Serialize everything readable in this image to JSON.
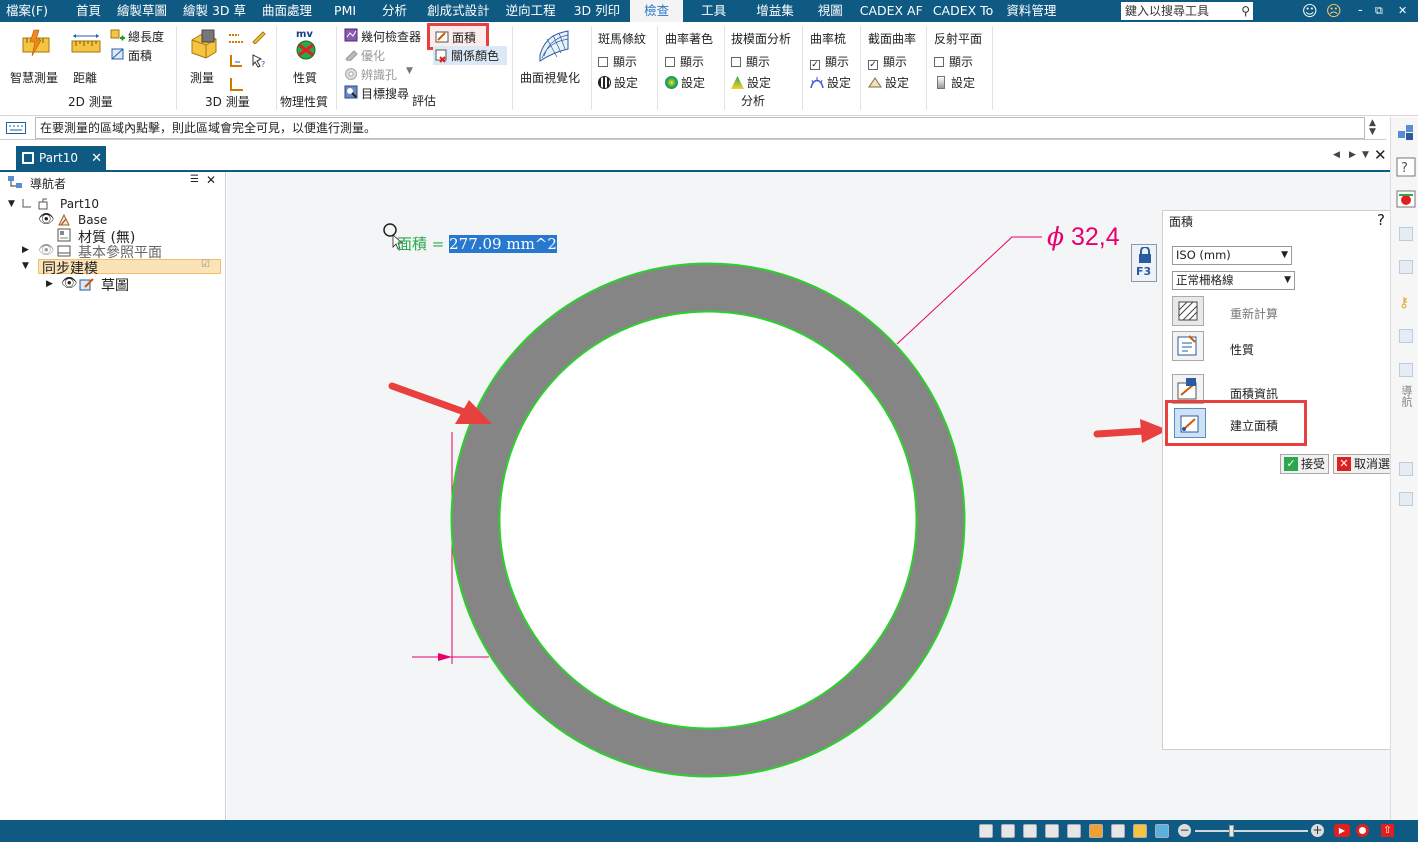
{
  "menubar": {
    "file": "檔案(F)",
    "items": [
      "首頁",
      "繪製草圖",
      "繪製 3D 草",
      "曲面處理",
      "PMI",
      "分析",
      "創成式設計",
      "逆向工程",
      "3D 列印",
      "檢查",
      "工具",
      "增益集",
      "視圖",
      "CADEX AF",
      "CADEX To",
      "資料管理"
    ],
    "active_index": 9,
    "search_placeholder": "鍵入以搜尋工具",
    "window_controls": [
      "-",
      "⧉",
      "✕"
    ]
  },
  "ribbon": {
    "smart_measure": "智慧測量",
    "distance": "距離",
    "total_length": "總長度",
    "area_small": "面積",
    "group_2d": "2D 測量",
    "measure": "測量",
    "group_3d": "3D 測量",
    "mv_badge": "mv",
    "properties": "性質",
    "group_physical": "物理性質",
    "geometry_inspector": "幾何檢查器",
    "area_highlight": "面積",
    "optimize": "優化",
    "relation_color": "關係顏色",
    "identify_holes": "辨識孔",
    "target_search": "目標搜尋",
    "group_evaluate": "評估",
    "surface_visualization": "曲面視覺化",
    "zebra": "斑馬條紋",
    "curvature_shade": "曲率著色",
    "draft_analysis": "拔模面分析",
    "curvature_comb": "曲率梳",
    "section_curvature": "截面曲率",
    "reflective_plane": "反射平面",
    "show": "顯示",
    "settings": "設定",
    "group_analysis": "分析"
  },
  "prompt": {
    "text": "在要測量的區域內點擊，則此區域會完全可見，以便進行測量。"
  },
  "tabs": {
    "doc_tab": "Part10"
  },
  "navigator": {
    "title": "導航者",
    "root": "Part10",
    "base": "Base",
    "material": "材質 (無)",
    "ref_planes": "基本參照平面",
    "sync_modeling": "同步建模",
    "sketch": "草圖"
  },
  "canvas": {
    "area_label": "面積 = ",
    "area_value": "277.09 mm^2",
    "diameter_symbol": "ϕ",
    "diameter_value": "32,4",
    "f3_label": "F3"
  },
  "panel": {
    "title": "面積",
    "help": "?",
    "close": "✕",
    "unit_select": "ISO (mm)",
    "grid_select": "正常柵格線",
    "recalculate": "重新計算",
    "properties": "性質",
    "area_info": "面積資訊",
    "create_area": "建立面積",
    "accept": "接受",
    "cancel_select": "取消選取"
  },
  "rail": {
    "vertical_label": "導航"
  },
  "colors": {
    "menubar": "#0e5a82",
    "annotation": "#e8006e",
    "highlight_box": "#e8403f",
    "ring_fill": "#858585",
    "ring_edge": "#2cd02c",
    "area_text": "#2aa84a",
    "selection_bg": "#2878d0"
  }
}
